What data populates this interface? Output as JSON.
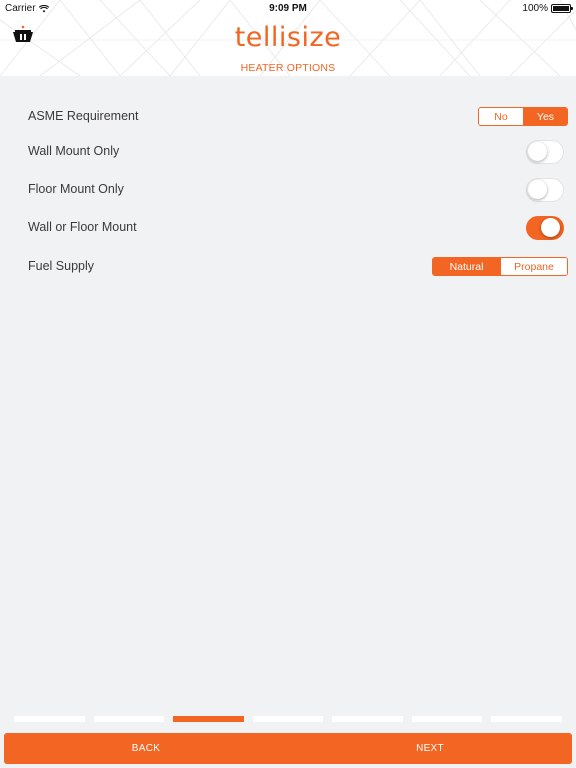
{
  "status_bar": {
    "carrier": "Carrier",
    "time": "9:09 PM",
    "battery": "100%"
  },
  "header": {
    "logo": "tellisize",
    "subtitle": "HEATER OPTIONS"
  },
  "options": {
    "asme": {
      "label": "ASME Requirement",
      "segments": [
        "No",
        "Yes"
      ],
      "selected": "Yes"
    },
    "wall_mount": {
      "label": "Wall Mount Only",
      "on": false
    },
    "floor_mount": {
      "label": "Floor Mount Only",
      "on": false
    },
    "wall_or_floor": {
      "label": "Wall or Floor Mount",
      "on": true
    },
    "fuel_supply": {
      "label": "Fuel Supply",
      "segments": [
        "Natural",
        "Propane"
      ],
      "selected": "Natural"
    }
  },
  "progress": {
    "total_steps": 7,
    "current_step": 3
  },
  "footer": {
    "back_label": "BACK",
    "next_label": "NEXT"
  },
  "colors": {
    "accent": "#f26522",
    "background": "#f1f2f4",
    "header_bg": "#ffffff"
  }
}
